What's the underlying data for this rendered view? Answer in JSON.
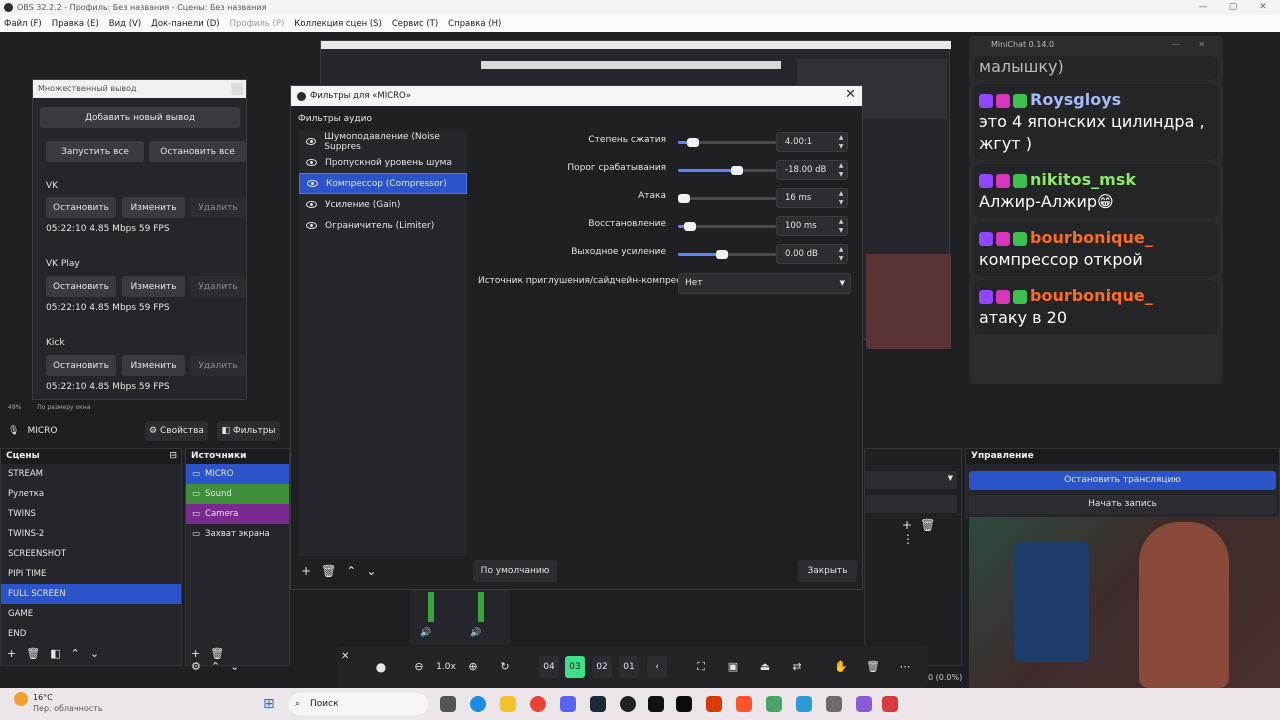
{
  "window": {
    "title": "OBS 32.2.2 - Профиль: Без названия - Сцены: Без названия"
  },
  "menu": [
    "Файл (F)",
    "Правка (E)",
    "Вид (V)",
    "Док-панели (D)",
    "Профиль (P)",
    "Коллекция сцен (S)",
    "Сервис (T)",
    "Справка (H)"
  ],
  "multi_output": {
    "title": "Множественный вывод",
    "add_label": "Добавить новый вывод",
    "start_all": "Запустить все",
    "stop_all": "Остановить все",
    "outputs": [
      {
        "name": "VK",
        "stop": "Остановить",
        "edit": "Изменить",
        "delete": "Удалить",
        "stats": "05:22:10  4.85 Mbps  59 FPS"
      },
      {
        "name": "VK Play",
        "stop": "Остановить",
        "edit": "Изменить",
        "delete": "Удалить",
        "stats": "05:22:10  4.85 Mbps  59 FPS"
      },
      {
        "name": "Kick",
        "stop": "Остановить",
        "edit": "Изменить",
        "delete": "Удалить",
        "stats": "05:22:10  4.85 Mbps  59 FPS"
      }
    ]
  },
  "preview_status": {
    "zoom": "49%",
    "fit": "По размеру окна"
  },
  "filters": {
    "title": "Фильтры для «MICRO»",
    "section": "Фильтры аудио",
    "items": [
      {
        "label": "Шумоподавление (Noise Suppres",
        "selected": false
      },
      {
        "label": "Пропускной уровень шума",
        "selected": false
      },
      {
        "label": "Компрессор (Compressor)",
        "selected": true
      },
      {
        "label": "Усиление (Gain)",
        "selected": false
      },
      {
        "label": "Ограничитель (Limiter)",
        "selected": false
      }
    ],
    "params": [
      {
        "label": "Степень сжатия",
        "value": "4.00:1",
        "fraction": 0.15
      },
      {
        "label": "Порог срабатывания",
        "value": "-18.00 dB",
        "fraction": 0.6
      },
      {
        "label": "Атака",
        "value": "16 ms",
        "fraction": 0.06
      },
      {
        "label": "Восстановление",
        "value": "100 ms",
        "fraction": 0.12
      },
      {
        "label": "Выходное усиление",
        "value": "0.00 dB",
        "fraction": 0.45
      }
    ],
    "sidechain_label": "Источник приглушения/сайдчейн-компрессии",
    "sidechain_value": "Нет",
    "defaults_label": "По умолчанию",
    "close_label": "Закрыть"
  },
  "source_bar": {
    "name": "MICRO",
    "props": "Свойства",
    "filters": "Фильтры"
  },
  "scenes": {
    "title": "Сцены",
    "items": [
      {
        "label": "STREAM",
        "selected": false
      },
      {
        "label": "Рулетка",
        "selected": false
      },
      {
        "label": "TWINS",
        "selected": false
      },
      {
        "label": "TWINS-2",
        "selected": false
      },
      {
        "label": "SCREENSHOT",
        "selected": false
      },
      {
        "label": "PIPI TIME",
        "selected": false
      },
      {
        "label": "FULL SCREEN",
        "selected": true
      },
      {
        "label": "GAME",
        "selected": false
      },
      {
        "label": "END",
        "selected": false
      }
    ]
  },
  "sources": {
    "title": "Источники",
    "items": [
      {
        "label": "MICRO",
        "color": "#2b54c8"
      },
      {
        "label": "Sound",
        "color": "#3d8f3a"
      },
      {
        "label": "Camera",
        "color": "#7a2a8f"
      },
      {
        "label": "Захват экрана",
        "color": ""
      }
    ]
  },
  "controls": {
    "title": "Управление",
    "stop_stream": "Остановить трансляцию",
    "start_record": "Начать запись"
  },
  "chat": {
    "title": "MiniChat 0.14.0",
    "cut_top": "малышку)",
    "messages": [
      {
        "user": "Roysgloys",
        "user_color": "#a9b8ff",
        "text": "это 4 японских цилиндра , жгут )"
      },
      {
        "user": "nikitos_msk",
        "user_color": "#8de86a",
        "text": "Алжир-Алжир😁"
      },
      {
        "user": "bourbonique_",
        "user_color": "#ff6a2a",
        "text": "компрессор открой"
      },
      {
        "user": "bourbonique_",
        "user_color": "#ff6a2a",
        "text": "атаку в 20"
      }
    ]
  },
  "zoom_toolbar": {
    "zoom": "1.0x",
    "pages": [
      "04",
      "03",
      "02",
      "01"
    ],
    "active_page": "03"
  },
  "status_right": "0 (0.0%)",
  "taskbar": {
    "temp": "16°C",
    "weather": "Пер. облачность",
    "search": "Поиск"
  },
  "colors": {
    "accent": "#2b54c8",
    "green_active": "#3fe08a"
  }
}
